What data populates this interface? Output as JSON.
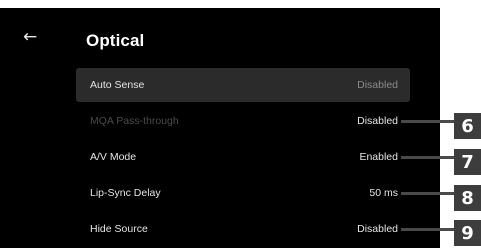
{
  "header": {
    "back_icon": "arrow-left-icon",
    "title": "Optical"
  },
  "settings": [
    {
      "label": "Auto Sense",
      "value": "Disabled",
      "state": "selected"
    },
    {
      "label": "MQA Pass-through",
      "value": "Disabled",
      "state": "disabled"
    },
    {
      "label": "A/V Mode",
      "value": "Enabled",
      "state": "normal"
    },
    {
      "label": "Lip-Sync Delay",
      "value": "50 ms",
      "state": "normal"
    },
    {
      "label": "Hide Source",
      "value": "Disabled",
      "state": "normal"
    }
  ],
  "callouts": [
    "6",
    "7",
    "8",
    "9"
  ],
  "colors": {
    "background": "#000000",
    "selected_row": "#2b2b2b",
    "disabled_text": "#4a4a4a",
    "callout_badge": "#3d3d3d"
  }
}
